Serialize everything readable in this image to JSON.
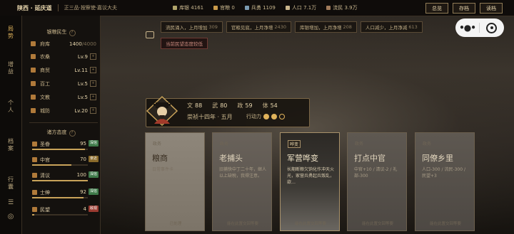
{
  "topbar": {
    "location": "陕西 · 延庆道",
    "rank": "正三品·按察使·嘉议大夫",
    "stats": [
      {
        "label": "库银",
        "value": "4161",
        "icon": "silver-icon",
        "color": "#b0a46a"
      },
      {
        "label": "官粮",
        "value": "0",
        "icon": "grain-icon",
        "color": "#c99a4a"
      },
      {
        "label": "兵勇",
        "value": "1109",
        "icon": "soldier-icon",
        "color": "#7a9ab0"
      },
      {
        "label": "人口",
        "value": "7.1万",
        "icon": "population-icon",
        "color": "#c9b58c"
      },
      {
        "label": "流民",
        "value": "3.9万",
        "icon": "refugee-icon",
        "color": "#a07a5a"
      }
    ],
    "buttons": {
      "overview": "总览",
      "save": "存档",
      "load": "读档"
    }
  },
  "nav": [
    {
      "label": "局势",
      "active": true
    },
    {
      "label": "增益",
      "active": false
    },
    {
      "label": "个人",
      "active": false
    },
    {
      "label": "档案",
      "active": false
    },
    {
      "label": "行囊",
      "active": false
    }
  ],
  "livelihood": {
    "title": "银粮民生",
    "items": [
      {
        "label": "府库",
        "value": "1400",
        "max": "/4000"
      },
      {
        "label": "农桑",
        "value": "Lv.9"
      },
      {
        "label": "商贸",
        "value": "Lv.11"
      },
      {
        "label": "百工",
        "value": "Lv.5"
      },
      {
        "label": "文教",
        "value": "Lv.5"
      },
      {
        "label": "城防",
        "value": "Lv.20"
      }
    ]
  },
  "factions": {
    "title": "诸方态度",
    "items": [
      {
        "label": "圣眷",
        "value": "95",
        "tag": "深信",
        "tag_color": "#3f7a4a",
        "fill": 0.95
      },
      {
        "label": "中官",
        "value": "70",
        "tag": "亲近",
        "tag_color": "#8a6a2a",
        "fill": 0.7
      },
      {
        "label": "清议",
        "value": "100",
        "tag": "深信",
        "tag_color": "#3f7a4a",
        "fill": 1.0
      },
      {
        "label": "士绅",
        "value": "92",
        "tag": "深信",
        "tag_color": "#3f7a4a",
        "fill": 0.92
      },
      {
        "label": "民望",
        "value": "4",
        "tag": "敌视",
        "tag_color": "#9a3a30",
        "fill": 0.04
      }
    ]
  },
  "notices": [
    {
      "text": "流民涌入，上月增加",
      "num": "309"
    },
    {
      "text": "官粮见底，上月净增",
      "num": "2430"
    },
    {
      "text": "库银增加，上月净增",
      "num": "208"
    },
    {
      "text": "人口减少，上月净减",
      "num": "613"
    }
  ],
  "warning": "当前民望态度较低",
  "player": {
    "attrs": [
      {
        "label": "文",
        "value": "88"
      },
      {
        "label": "武",
        "value": "80"
      },
      {
        "label": "政",
        "value": "59"
      },
      {
        "label": "体",
        "value": "54"
      }
    ],
    "date": "崇祯十四年 · 五月",
    "action_label": "行动力",
    "action_points": 2,
    "action_max": 3
  },
  "cards": [
    {
      "type": "政务",
      "title": "粮商",
      "desc": "日常事件卡",
      "foot": "已处理"
    },
    {
      "type": "政务",
      "title": "老捕头",
      "desc": "旧捕快中丁二十年，继人以上缺税，我得注意。",
      "foot": "能在此置交回等要"
    },
    {
      "type": "哗变",
      "title": "军营哗变",
      "desc": "长期断粮欠饷化作冲天火光，家营兵勇起兵叛乱，欲…",
      "foot": "能在此置交回等要"
    },
    {
      "type": "政务",
      "title": "打点中官",
      "desc": "中官+10 / 清议-2 / 礼部-300",
      "foot": "能在此置交回等要"
    },
    {
      "type": "政务",
      "title": "同僚乡里",
      "desc": "人口-300 / 流民-300 / 民望+3",
      "foot": "能在此置交回等要"
    }
  ]
}
